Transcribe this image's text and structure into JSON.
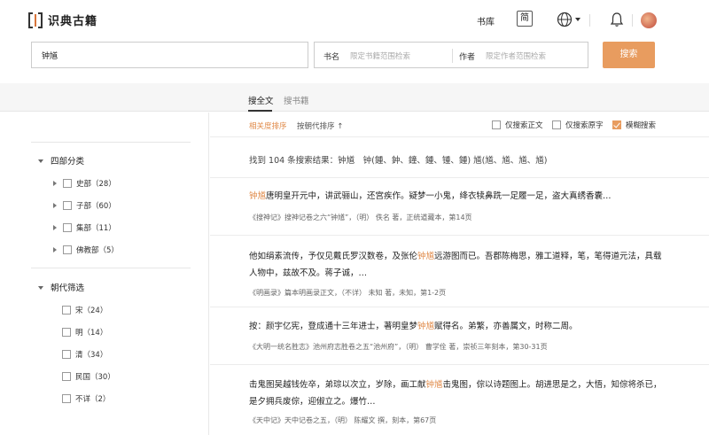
{
  "header": {
    "logo_text": "识典古籍",
    "library_label": "书库",
    "lang_toggle": "简",
    "icons": [
      "logo-icon",
      "globe-icon",
      "bell-icon",
      "avatar"
    ]
  },
  "search": {
    "query": "钟馗",
    "book_label": "书名",
    "book_placeholder": "限定书籍范围检索",
    "author_label": "作者",
    "author_placeholder": "限定作者范围检索",
    "button_label": "搜索"
  },
  "tabs": [
    {
      "label": "搜全文",
      "active": true
    },
    {
      "label": "搜书籍",
      "active": false
    }
  ],
  "sidebar": {
    "group1": {
      "title": "四部分类",
      "items": [
        {
          "label": "史部（28）"
        },
        {
          "label": "子部（60）"
        },
        {
          "label": "集部（11）"
        },
        {
          "label": "佛教部（5）"
        }
      ]
    },
    "group2": {
      "title": "朝代筛选",
      "items": [
        {
          "label": "宋（24）"
        },
        {
          "label": "明（14）"
        },
        {
          "label": "清（34）"
        },
        {
          "label": "民国（30）"
        },
        {
          "label": "不详（2）"
        }
      ]
    }
  },
  "sort": {
    "relevance": "相关度排序",
    "dynasty": "按朝代排序 ↑",
    "opt_body": "仅搜索正文",
    "opt_original": "仅搜索原字",
    "opt_fuzzy": "模糊搜索",
    "fuzzy_checked": true
  },
  "summary": "找到 104 条搜索结果：钟馗　钟(鍾、鈡、鐘、鍾、锺、鍾) 馗(馗、馗、馗、馗)",
  "results": [
    {
      "pre": "",
      "hl": "钟馗",
      "post": "唐明皇开元中，讲武骊山，还宫疾作。疑梦一小鬼，绛衣犊鼻跣一足履一足，盗大真绣香囊…",
      "meta": "《搜神记》搜神记卷之六“钟馗”，（明） 佚名 著，正统道藏本，第14页"
    },
    {
      "pre": "他如绢素流传，予仅见戴氏罗汉数卷，及张伦",
      "hl": "钟馗",
      "post": "远游图而已。吾郡陈梅思，雅工道释，笔，笔得道元法，具载人物中，兹故不及。蒋子诚，…",
      "meta": "《明画录》篇本明画录正文，（不详） 未知 著，未知，第1-2页"
    },
    {
      "pre": "按：颜宇亿宪，登成通十三年进士，著明皇梦",
      "hl": "钟馗",
      "post": "赋得名。弟繁，亦善属文，时称二周。",
      "meta": "《大明一统名胜志》池州府志胜卷之五“池州府”，（明） 曹学佺 著，崇祯三年刻本，第30-31页"
    },
    {
      "pre": "击鬼图吴越钱佐卒，弟琮以次立，岁除，画工献",
      "hl": "钟馗",
      "post": "击鬼图，倧以诗题图上。胡进思是之，大悟，知倧将杀已，是夕拥兵废倧，迎俶立之。爆竹…",
      "meta": "《天中记》天中记卷之五，（明） 陈耀文 撰，刻本，第67页"
    }
  ]
}
